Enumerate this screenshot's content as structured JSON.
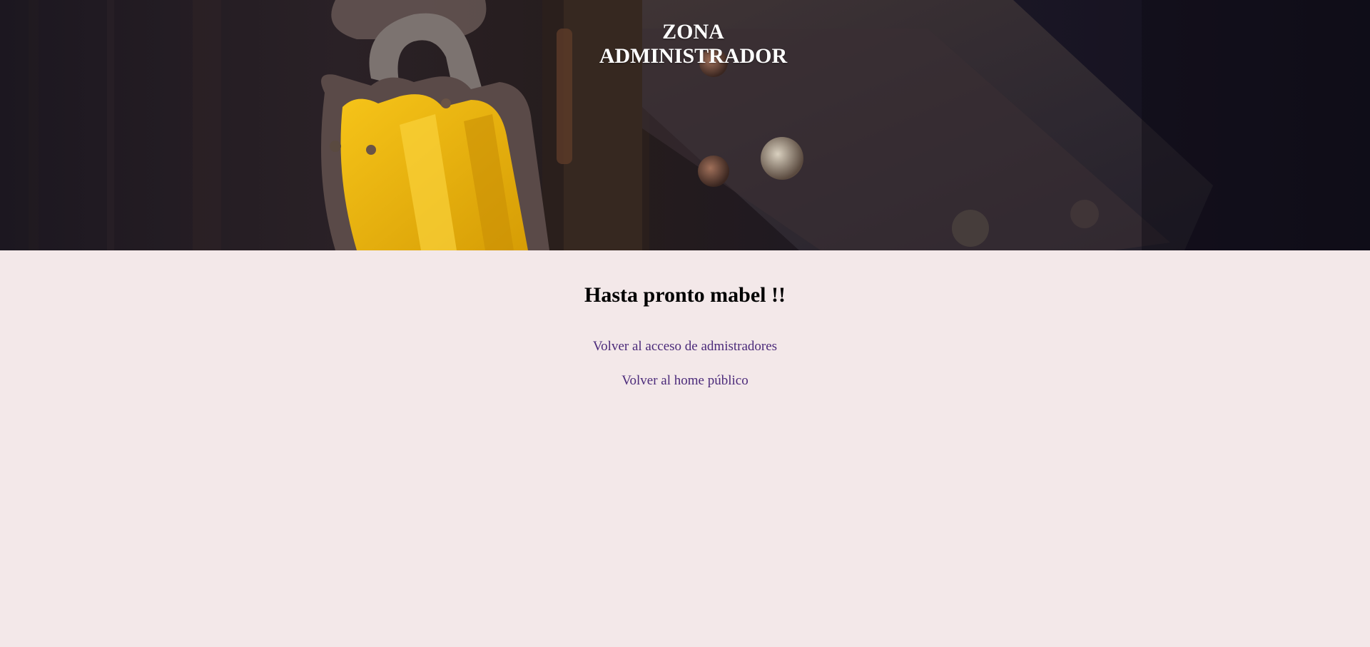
{
  "header": {
    "title_line1": "ZONA",
    "title_line2": "ADMINISTRADOR",
    "banner_image": "yellow-padlock-on-door-hinge"
  },
  "main": {
    "farewell": "Hasta pronto mabel !!",
    "links": [
      {
        "label": "Volver al acceso de admistradores"
      },
      {
        "label": "Volver al home público"
      }
    ]
  },
  "colors": {
    "page_background": "#f3e8e9",
    "link": "#4b2a7a",
    "header_text": "#ffffff"
  }
}
